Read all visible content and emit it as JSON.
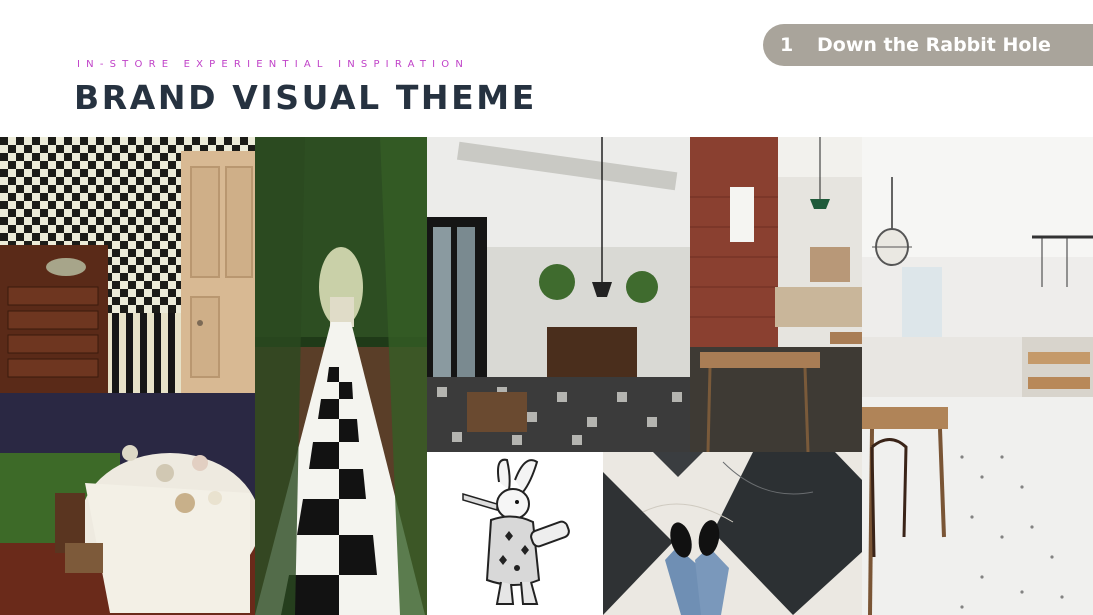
{
  "header": {
    "eyebrow": "IN-STORE EXPERIENTIAL INSPIRATION",
    "title": "BRAND VISUAL THEME"
  },
  "section_pill": {
    "number": "1",
    "label": "Down the Rabbit Hole"
  },
  "colors": {
    "eyebrow": "#c042c8",
    "title": "#263240",
    "pill": "#a9a49b"
  },
  "photos": [
    "checkered-wallpaper-room-photo",
    "garden-checkered-path-photo",
    "industrial-cafe-interior-photo",
    "brick-cafe-interior-photo",
    "white-bakery-cafe-photo",
    "tea-party-table-photo",
    "white-rabbit-illustration",
    "marble-diamond-floor-photo"
  ]
}
